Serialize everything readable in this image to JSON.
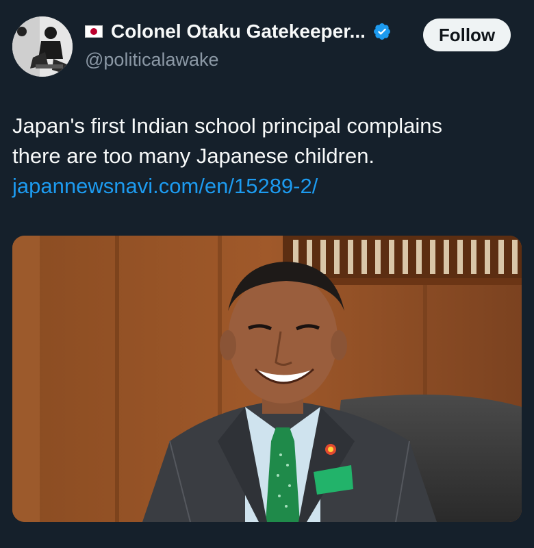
{
  "author": {
    "flag": "japan-flag",
    "display_name": "Colonel Otaku Gatekeeper...",
    "handle": "@politicalawake",
    "verified": true
  },
  "actions": {
    "follow_label": "Follow"
  },
  "tweet": {
    "text_line1": "Japan's first Indian school principal complains",
    "text_line2": "there are too many Japanese children.",
    "link": "japannewsnavi.com/en/15289-2/"
  },
  "media": {
    "subject": "photo-of-smiling-man-in-suit-and-green-tie"
  },
  "colors": {
    "background": "#15202b",
    "text": "#f7f9f9",
    "secondary_text": "#8b98a5",
    "link": "#1d9bf0",
    "verified_badge": "#1d9bf0",
    "follow_button_bg": "#eff3f4"
  }
}
